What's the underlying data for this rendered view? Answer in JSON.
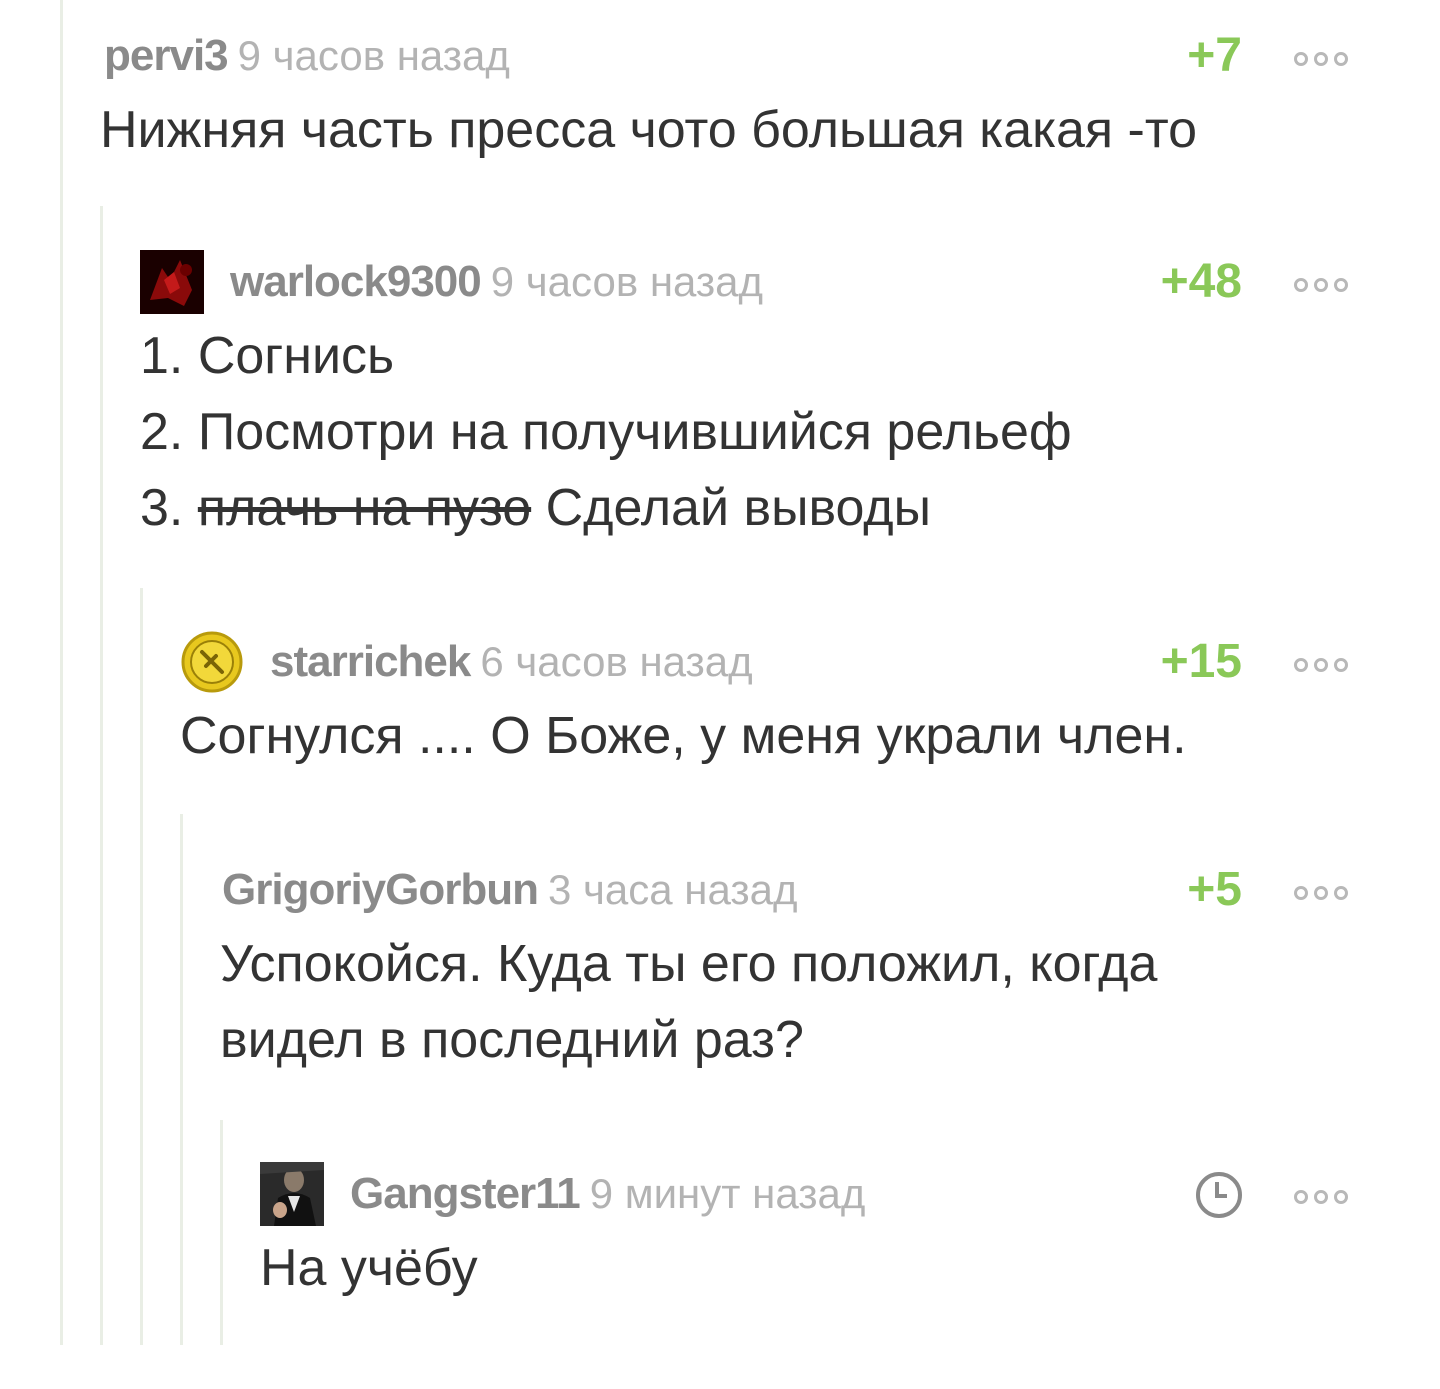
{
  "colors": {
    "rating": "#8ac858",
    "author": "#8a8a8a",
    "time": "#b3b3b3",
    "text": "#333333",
    "thread_line": "#e9eee5"
  },
  "comments": [
    {
      "author": "pervi3",
      "time": "9 часов назад",
      "rating": "+7",
      "has_avatar": false,
      "lines": [
        "Нижняя часть пресса чото большая какая -то"
      ]
    },
    {
      "author": "warlock9300",
      "time": "9 часов назад",
      "rating": "+48",
      "has_avatar": true,
      "avatar_icon": "red-dark-avatar-icon",
      "line1": "1. Согнись",
      "line2": "2. Посмотри на получившийся рельеф",
      "line3_prefix": "3. ",
      "line3_strike": "плачь на пузо",
      "line3_rest": " Сделай выводы"
    },
    {
      "author": "starrichek",
      "time": "6 часов назад",
      "rating": "+15",
      "has_avatar": true,
      "avatar_icon": "yellow-badge-avatar-icon",
      "lines": [
        "Согнулся .... О Боже, у меня украли член."
      ]
    },
    {
      "author": "GrigoriyGorbun",
      "time": "3 часа назад",
      "rating": "+5",
      "has_avatar": false,
      "lines": [
        "Успокойся. Куда ты его положил, когда",
        "видел в последний раз?"
      ]
    },
    {
      "author": "Gangster11",
      "time": "9 минут назад",
      "rating_icon": "clock-icon",
      "has_avatar": true,
      "avatar_icon": "godfather-avatar-icon",
      "lines": [
        "На учёбу"
      ]
    }
  ]
}
